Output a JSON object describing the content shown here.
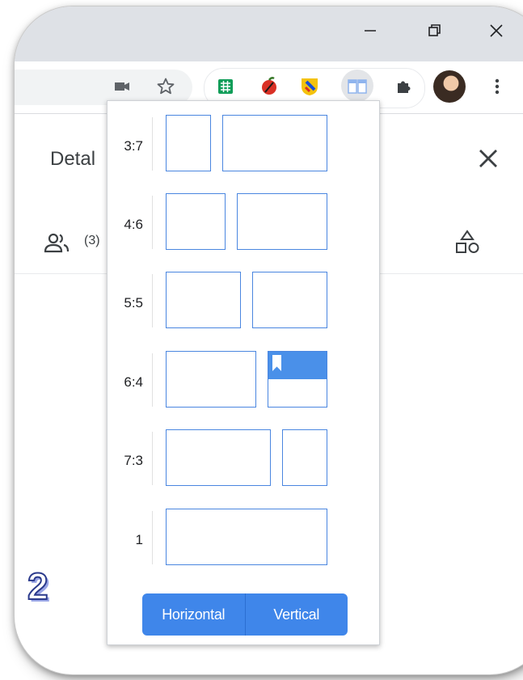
{
  "window": {
    "buttons": [
      "minimize",
      "restore",
      "close"
    ]
  },
  "toolbar": {
    "icons": [
      "camera-icon",
      "star-icon",
      "sheets-extension-icon",
      "apple-extension-icon",
      "shield-extension-icon",
      "split-screen-extension-icon",
      "puzzle-icon",
      "avatar",
      "more-vert-icon"
    ]
  },
  "page": {
    "title": "Detal",
    "people_count": "(3)"
  },
  "popup": {
    "rows": [
      {
        "ratio": "3:7",
        "left_fraction": 0.3,
        "selected": false
      },
      {
        "ratio": "4:6",
        "left_fraction": 0.4,
        "selected": false
      },
      {
        "ratio": "5:5",
        "left_fraction": 0.5,
        "selected": false
      },
      {
        "ratio": "6:4",
        "left_fraction": 0.6,
        "selected": true
      },
      {
        "ratio": "7:3",
        "left_fraction": 0.7,
        "selected": false
      },
      {
        "ratio": "1",
        "left_fraction": 1.0,
        "selected": false
      }
    ],
    "horizontal_label": "Horizontal",
    "vertical_label": "Vertical"
  },
  "badge": "2",
  "colors": {
    "accent": "#4a90e9",
    "outline": "#4a86e0",
    "button": "#3f86ea"
  }
}
